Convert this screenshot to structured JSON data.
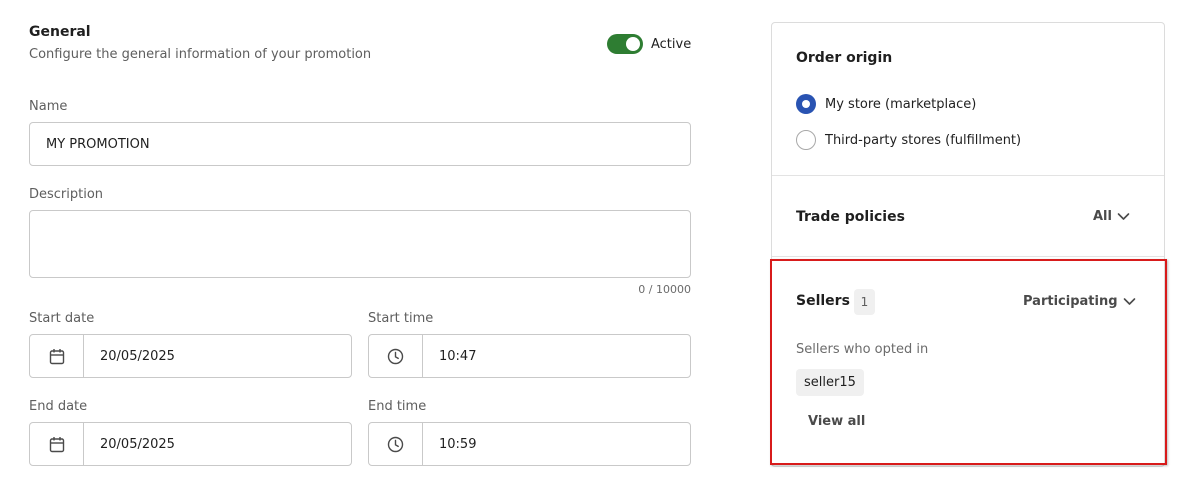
{
  "general": {
    "title": "General",
    "subtitle": "Configure the general information of your promotion",
    "active_label": "Active",
    "active": true
  },
  "name_field": {
    "label": "Name",
    "value": "MY PROMOTION"
  },
  "description_field": {
    "label": "Description",
    "value": "",
    "counter": "0 / 10000"
  },
  "start_date": {
    "label": "Start date",
    "value": "20/05/2025",
    "icon": "calendar-icon"
  },
  "start_time": {
    "label": "Start time",
    "value": "10:47",
    "icon": "clock-icon"
  },
  "end_date": {
    "label": "End date",
    "value": "20/05/2025",
    "icon": "calendar-icon"
  },
  "end_time": {
    "label": "End time",
    "value": "10:59",
    "icon": "clock-icon"
  },
  "order_origin": {
    "title": "Order origin",
    "options": [
      {
        "label": "My store (marketplace)",
        "selected": true
      },
      {
        "label": "Third-party stores (fulfillment)",
        "selected": false
      }
    ]
  },
  "trade_policies": {
    "title": "Trade policies",
    "filter": "All"
  },
  "sellers": {
    "title": "Sellers",
    "count": "1",
    "filter": "Participating",
    "caption": "Sellers who opted in",
    "chips": [
      "seller15"
    ],
    "view_all": "View all"
  },
  "colors": {
    "toggle_on": "#2e7d32",
    "radio_selected": "#2953b2",
    "highlight": "#d81b1b"
  }
}
